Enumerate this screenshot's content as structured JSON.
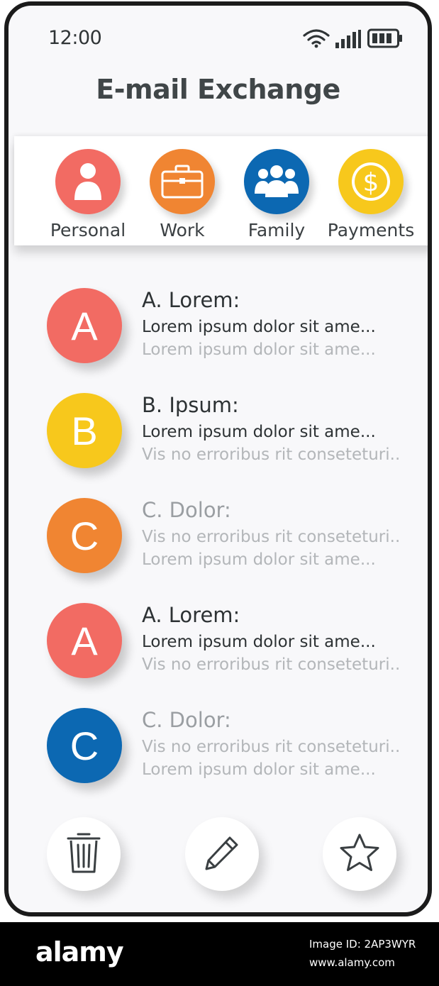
{
  "status_bar": {
    "time": "12:00",
    "icons": [
      "wifi-icon",
      "signal-icon",
      "battery-icon"
    ]
  },
  "app": {
    "title": "E-mail Exchange"
  },
  "categories": [
    {
      "label": "Personal",
      "icon": "person-icon",
      "color": "#f26b63"
    },
    {
      "label": "Work",
      "icon": "briefcase-icon",
      "color": "#f08532"
    },
    {
      "label": "Family",
      "icon": "people-icon",
      "color": "#0c68b2"
    },
    {
      "label": "Payments",
      "icon": "dollar-coin-icon",
      "color": "#f7c81c"
    }
  ],
  "emails": [
    {
      "letter": "A",
      "color": "#f26b63",
      "sender": "A. Lorem:",
      "line1": "Lorem   ipsum   dolor   sit   ame...",
      "line2": "Lorem   ipsum   dolor   sit   ame...",
      "unread": true
    },
    {
      "letter": "B",
      "color": "#f7c81c",
      "sender": "B. Ipsum:",
      "line1": "Lorem   ipsum   dolor   sit   ame...",
      "line2": "Vis no erroribus rit conseteturi...",
      "unread": true
    },
    {
      "letter": "C",
      "color": "#f08532",
      "sender": "C. Dolor:",
      "line1": "Vis no erroribus rit conseteturi...",
      "line2": "Lorem   ipsum   dolor   sit   ame...",
      "unread": false
    },
    {
      "letter": "A",
      "color": "#f26b63",
      "sender": "A. Lorem:",
      "line1": "Lorem   ipsum   dolor   sit   ame...",
      "line2": "Vis no erroribus rit conseteturi...",
      "unread": true
    },
    {
      "letter": "C",
      "color": "#0c68b2",
      "sender": "C. Dolor:",
      "line1": "Vis no erroribus rit conseteturi...",
      "line2": "Lorem   ipsum   dolor   sit   ame...",
      "unread": false
    }
  ],
  "actions": [
    {
      "icon": "trash-icon"
    },
    {
      "icon": "pencil-icon"
    },
    {
      "icon": "star-icon"
    }
  ],
  "watermark": {
    "brand": "alamy",
    "image_id": "Image ID: 2AP3WYR",
    "url": "www.alamy.com"
  }
}
